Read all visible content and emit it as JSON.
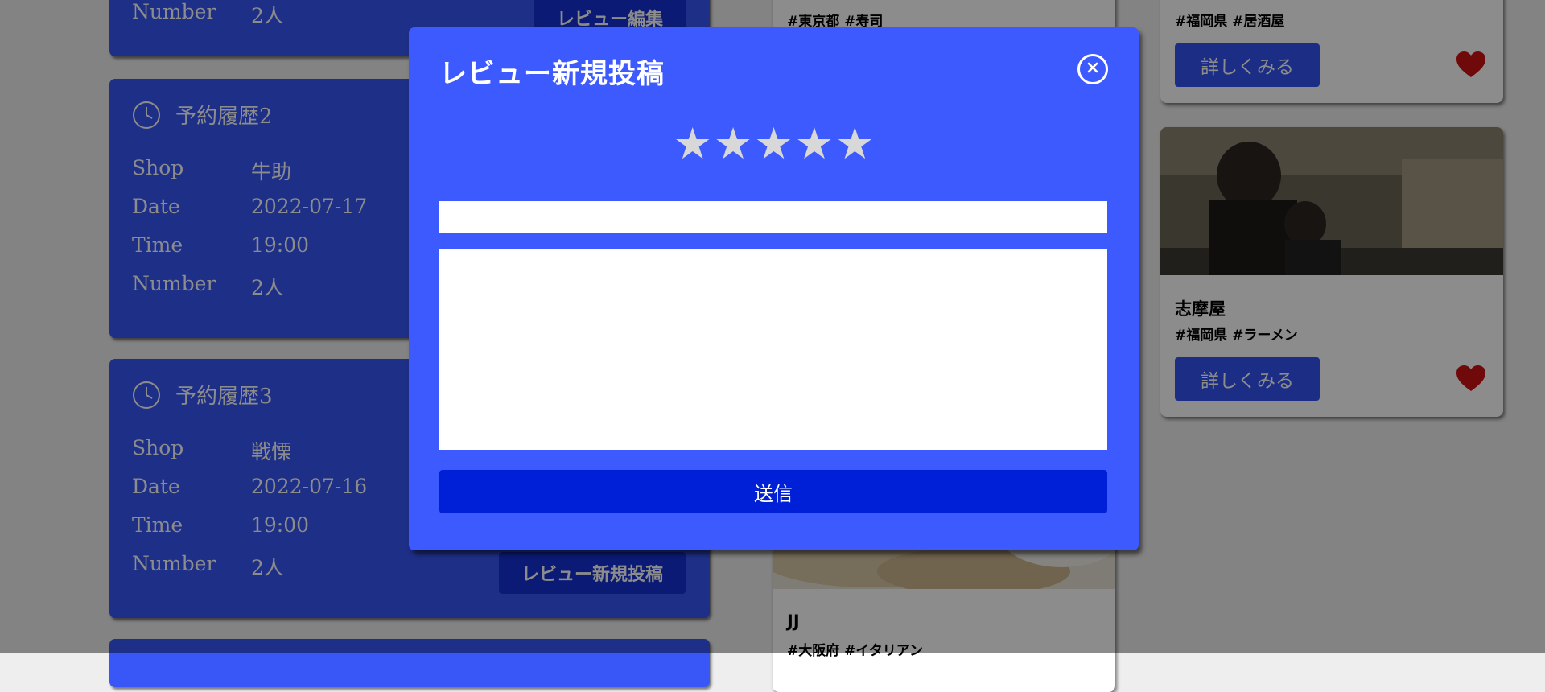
{
  "reservations": [
    {
      "title": "",
      "rows": [
        {
          "key": "Number",
          "value": "2人"
        }
      ],
      "button": "レビュー編集"
    },
    {
      "title": "予約履歴2",
      "rows": [
        {
          "key": "Shop",
          "value": "牛助"
        },
        {
          "key": "Date",
          "value": "2022-07-17"
        },
        {
          "key": "Time",
          "value": "19:00"
        },
        {
          "key": "Number",
          "value": "2人"
        }
      ]
    },
    {
      "title": "予約履歴3",
      "rows": [
        {
          "key": "Shop",
          "value": "戦慄"
        },
        {
          "key": "Date",
          "value": "2022-07-16"
        },
        {
          "key": "Time",
          "value": "19:00"
        },
        {
          "key": "Number",
          "value": "2人"
        }
      ],
      "button": "レビュー新規投稿"
    }
  ],
  "shops": [
    {
      "name": "",
      "tags": "#東京都 #寿司"
    },
    {
      "name": "JJ",
      "tags": "#大阪府 #イタリアン"
    },
    {
      "name": "",
      "tags": "#福岡県 #居酒屋",
      "button": "詳しくみる",
      "favorite": true
    },
    {
      "name": "志摩屋",
      "tags": "#福岡県 #ラーメン",
      "button": "詳しくみる",
      "favorite": true
    }
  ],
  "modal": {
    "title": "レビュー新規投稿",
    "stars": [
      "★",
      "★",
      "★",
      "★",
      "★"
    ],
    "title_input_value": "",
    "body_value": "",
    "submit": "送信"
  },
  "colors": {
    "modal_bg": "#3d5afe",
    "submit_bg": "#0020d8",
    "star": "#d8d8d8",
    "heart": "#cc1111"
  }
}
